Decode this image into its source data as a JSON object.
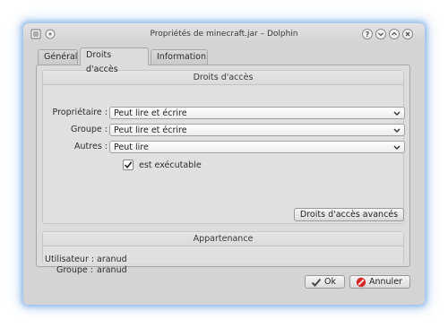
{
  "window": {
    "title": "Propriétés de minecraft.jar – Dolphin"
  },
  "tabs": [
    {
      "label": "Général",
      "active": false
    },
    {
      "label": "Droits d'accès",
      "active": true
    },
    {
      "label": "Information",
      "active": false
    }
  ],
  "access": {
    "title": "Droits d'accès",
    "rows": [
      {
        "label": "Propriétaire :",
        "value": "Peut lire et écrire"
      },
      {
        "label": "Groupe :",
        "value": "Peut lire et écrire"
      },
      {
        "label": "Autres :",
        "value": "Peut lire"
      }
    ],
    "executable": {
      "label": "est exécutable",
      "checked": true
    },
    "advanced_button": "Droits d'accès avancés"
  },
  "ownership": {
    "title": "Appartenance",
    "user_label": "Utilisateur :",
    "user_value": "aranud",
    "group_label": "Groupe :",
    "group_value": "aranud"
  },
  "buttons": {
    "ok": "Ok",
    "cancel": "Annuler"
  },
  "colors": {
    "window_glow": "#5a96dc",
    "cancel_icon": "#d42a2a",
    "panel_bg": "#dcdcdc"
  }
}
